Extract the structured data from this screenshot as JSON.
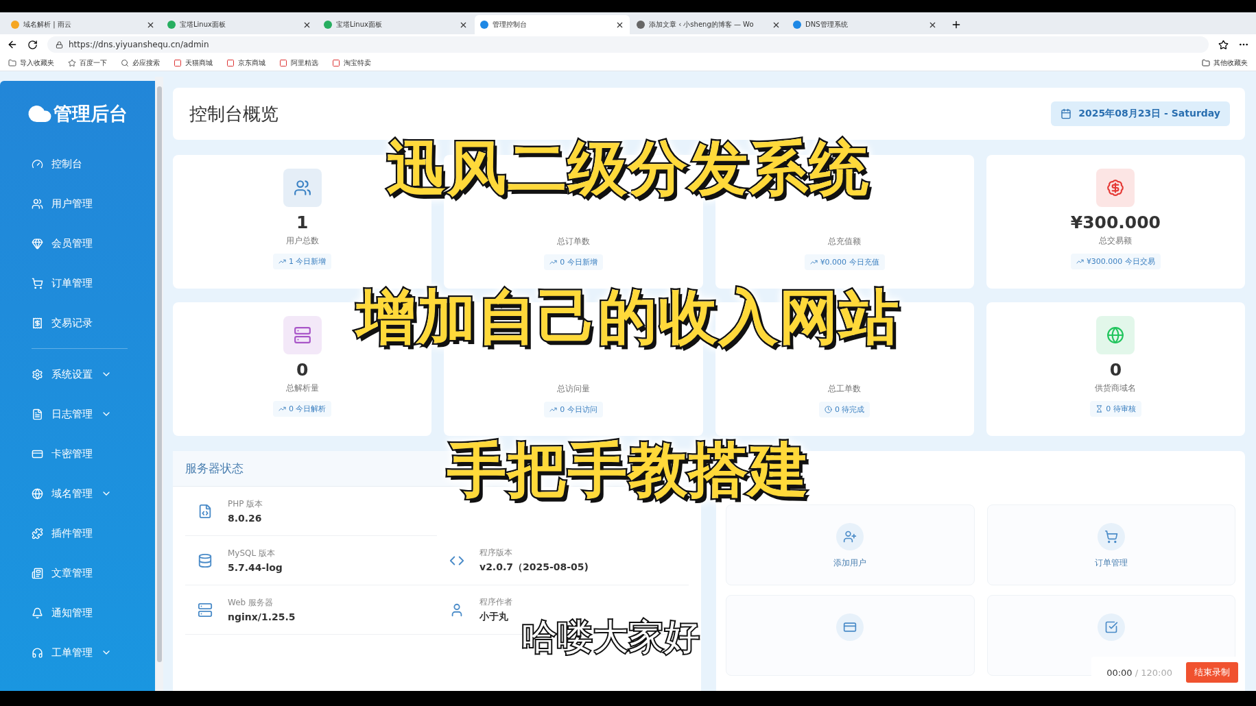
{
  "browser": {
    "tabs": [
      {
        "title": "域名解析 | 雨云",
        "selected": false
      },
      {
        "title": "宝塔Linux面板",
        "selected": false
      },
      {
        "title": "宝塔Linux面板",
        "selected": false
      },
      {
        "title": "管理控制台",
        "selected": true
      },
      {
        "title": "添加文章 ‹ 小sheng的博客 — Wo",
        "selected": false
      },
      {
        "title": "DNS管理系统",
        "selected": false
      }
    ],
    "url": "https://dns.yiyuanshequ.cn/admin",
    "bookmarks": [
      "导入收藏夹",
      "百度一下",
      "必应搜索",
      "天猫商城",
      "京东商城",
      "阿里精选",
      "淘宝特卖"
    ],
    "other_bookmarks": "其他收藏夹"
  },
  "sidebar": {
    "brand": "管理后台",
    "groups": [
      [
        {
          "label": "控制台",
          "expandable": false
        },
        {
          "label": "用户管理",
          "expandable": false
        },
        {
          "label": "会员管理",
          "expandable": false
        },
        {
          "label": "订单管理",
          "expandable": false
        },
        {
          "label": "交易记录",
          "expandable": false
        }
      ],
      [
        {
          "label": "系统设置",
          "expandable": true
        },
        {
          "label": "日志管理",
          "expandable": true
        },
        {
          "label": "卡密管理",
          "expandable": false
        },
        {
          "label": "域名管理",
          "expandable": true
        },
        {
          "label": "插件管理",
          "expandable": false
        },
        {
          "label": "文章管理",
          "expandable": false
        },
        {
          "label": "通知管理",
          "expandable": false
        },
        {
          "label": "工单管理",
          "expandable": true
        }
      ]
    ]
  },
  "header": {
    "title": "控制台概览",
    "date": "2025年08月23日 - Saturday"
  },
  "stats": [
    {
      "value": "1",
      "label": "用户总数",
      "sub": "1 今日新增",
      "color": "#3b82c4"
    },
    {
      "label": "总订单数",
      "sub": "0 今日新增"
    },
    {
      "label": "总充值额",
      "sub": "¥0.000 今日充值"
    },
    {
      "value": "¥300.000",
      "label": "总交易额",
      "sub": "¥300.000 今日交易",
      "color": "#e53935"
    },
    {
      "value": "0",
      "label": "总解析量",
      "sub": "0 今日解析",
      "color": "#a855c8"
    },
    {
      "label": "总访问量",
      "sub": "0 今日访问"
    },
    {
      "label": "总工单数",
      "sub": "0 待完成"
    },
    {
      "value": "0",
      "label": "供货商域名",
      "sub": "0 待审核",
      "color": "#22c55e"
    }
  ],
  "server": {
    "title": "服务器状态",
    "columns": [
      [
        {
          "label": "PHP 版本",
          "value": "8.0.26"
        },
        {
          "label": "MySQL 版本",
          "value": "5.7.44-log"
        },
        {
          "label": "Web 服务器",
          "value": "nginx/1.25.5"
        }
      ],
      [
        {
          "label": "程序版本",
          "value": "v2.0.7（2025-08-05)"
        },
        {
          "label": "程序作者",
          "value": "小于丸"
        }
      ]
    ]
  },
  "quick_actions": [
    {
      "label": "添加用户"
    },
    {
      "label": "订单管理"
    }
  ],
  "recorder": {
    "time": "00:00",
    "total": "/ 120:00",
    "button": "结束录制"
  },
  "captions": [
    "迅风二级分发系统",
    "增加自己的收入网站",
    "手把手教搭建"
  ],
  "subtitle": "哈喽大家好"
}
